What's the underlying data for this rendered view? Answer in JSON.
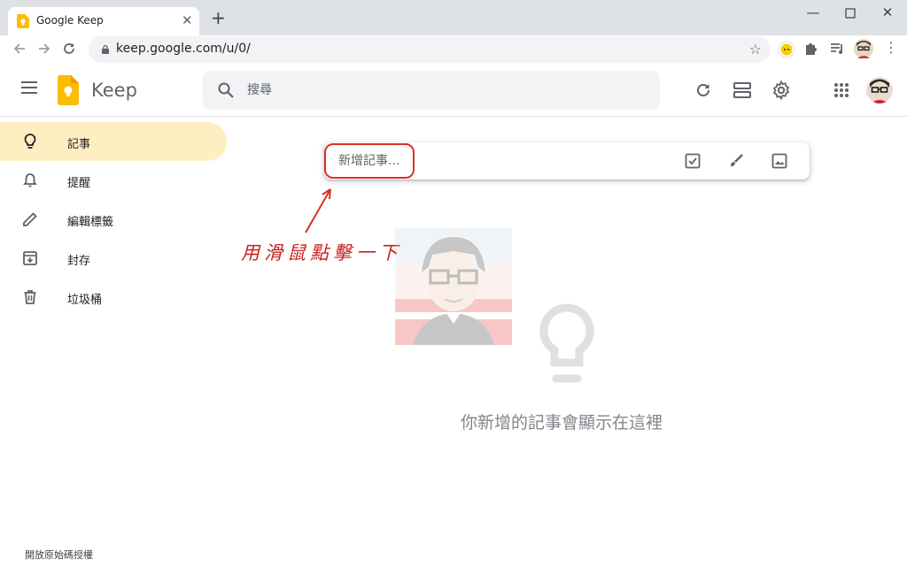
{
  "browser": {
    "tab_title": "Google Keep",
    "url": "keep.google.com/u/0/"
  },
  "app": {
    "brand": "Keep",
    "search_placeholder": "搜尋"
  },
  "sidebar": {
    "items": [
      {
        "label": "記事",
        "icon": "lightbulb-icon",
        "active": true
      },
      {
        "label": "提醒",
        "icon": "bell-icon",
        "active": false
      },
      {
        "label": "編輯標籤",
        "icon": "pencil-icon",
        "active": false
      },
      {
        "label": "封存",
        "icon": "archive-icon",
        "active": false
      },
      {
        "label": "垃圾桶",
        "icon": "trash-icon",
        "active": false
      }
    ],
    "footer_link": "開放原始碼授權"
  },
  "note": {
    "placeholder": "新增記事..."
  },
  "annotation": {
    "text": "用滑鼠點擊一下"
  },
  "empty_state": {
    "text": "你新增的記事會顯示在這裡"
  },
  "colors": {
    "keep_yellow": "#fbbc04",
    "active_nav": "#feefc3",
    "annotation_red": "#d93025"
  }
}
